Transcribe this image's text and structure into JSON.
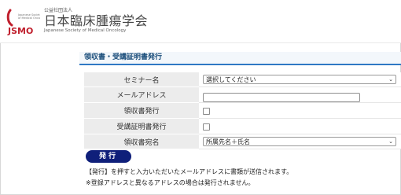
{
  "header": {
    "logo_mark_text": "JSMO",
    "logo_small_text": "公益社団法人",
    "org_name_ja": "日本臨床腫瘍学会",
    "org_name_en": "Japanese Society of Medical Oncology",
    "accent_color": "#c0202e"
  },
  "form": {
    "section_title": "領収書・受講証明書発行",
    "seminar": {
      "label": "セミナー名",
      "selected": "選択してください"
    },
    "email": {
      "label": "メールアドレス",
      "value": ""
    },
    "receipt": {
      "label": "領収書発行",
      "checked": false
    },
    "certificate": {
      "label": "受講証明書発行",
      "checked": false
    },
    "addressee": {
      "label": "領収書宛名",
      "selected": "所属先名＋氏名"
    },
    "submit_label": "発行",
    "note_line1": "【発行】を押すと入力いただいたメールアドレスに書類が送信されます。",
    "note_line2": "※登録アドレスと異なるアドレスの場合は発行されません。"
  }
}
